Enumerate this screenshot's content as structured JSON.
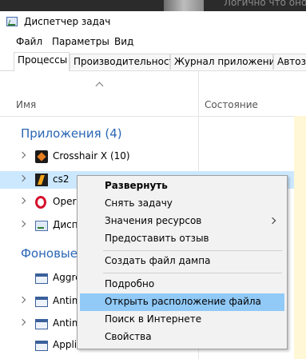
{
  "background_hint": {
    "ghost_text": "Логично что оно"
  },
  "window": {
    "title": "Диспетчер задач"
  },
  "menubar": {
    "file": "Файл",
    "params": "Параметры",
    "view": "Вид"
  },
  "tabs": [
    {
      "label": "Процессы",
      "active": true
    },
    {
      "label": "Производительность"
    },
    {
      "label": "Журнал приложений"
    },
    {
      "label": "Автоза"
    }
  ],
  "columns": {
    "name": "Имя",
    "status": "Состояние"
  },
  "groups": {
    "apps": "Приложения (4)",
    "background": "Фоновые"
  },
  "app_rows": [
    {
      "label": "Crosshair X (10)",
      "icon": "crosshair-x-icon"
    },
    {
      "label": "cs2",
      "icon": "cs2-icon",
      "selected": true
    },
    {
      "label": "Opera",
      "icon": "opera-icon"
    },
    {
      "label": "Диспе",
      "icon": "task-manager-icon"
    }
  ],
  "bg_rows": [
    {
      "label": "Aggre",
      "icon": "process-icon"
    },
    {
      "label": "Antim",
      "icon": "process-icon"
    },
    {
      "label": "Antim",
      "icon": "process-icon"
    },
    {
      "label": "Applic",
      "icon": "process-icon"
    }
  ],
  "context_menu": {
    "expand": "Развернуть",
    "end_task": "Снять задачу",
    "resource_values": "Значения ресурсов",
    "feedback": "Предоставить отзыв",
    "dump": "Создать файл дампа",
    "details": "Подробно",
    "open_location": "Открыть расположение файла",
    "search_online": "Поиск в Интернете",
    "properties": "Свойства"
  },
  "colors": {
    "accent_group": "#2a66b5",
    "selection": "#cce8ff",
    "menu_highlight": "#91c9f7",
    "status_column": "#fff7d6"
  }
}
